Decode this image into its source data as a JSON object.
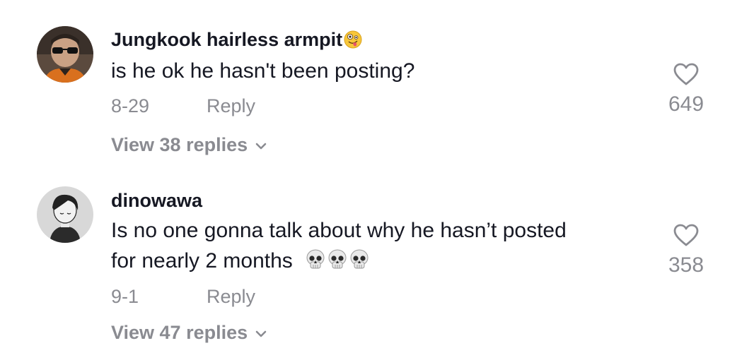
{
  "comments": [
    {
      "username": "Jungkook hairless armpit",
      "username_emoji": "zany-face-emoji",
      "text_lines": [
        "is he ok he hasn't been posting?"
      ],
      "date": "8-29",
      "reply_label": "Reply",
      "view_replies_label": "View 38 replies",
      "like_count": "649"
    },
    {
      "username": "dinowawa",
      "text_lines": [
        "Is no one gonna talk about why he hasn’t posted",
        "for nearly 2 months"
      ],
      "text_emoji": [
        "skull-emoji",
        "skull-emoji",
        "skull-emoji"
      ],
      "date": "9-1",
      "reply_label": "Reply",
      "view_replies_label": "View 47 replies",
      "like_count": "358"
    }
  ],
  "colors": {
    "primary_text": "#161823",
    "secondary_text": "#8a8b91",
    "background": "#ffffff"
  }
}
